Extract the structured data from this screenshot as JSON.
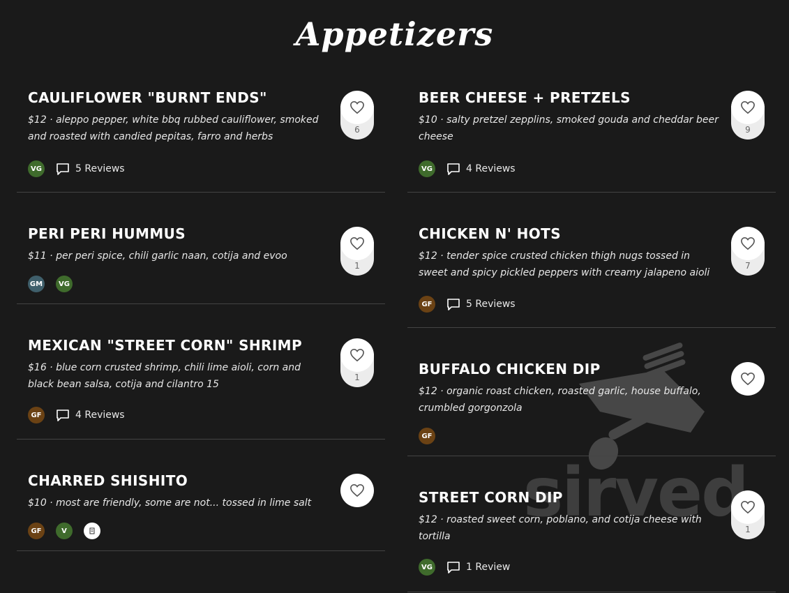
{
  "page": {
    "title": "Appetizers"
  },
  "colors": {
    "background": "#1a1a1a",
    "tag_VG": "#3f6b2c",
    "tag_GF": "#6b4214",
    "tag_GM": "#3f5f6b",
    "tag_V": "#3f6b2c"
  },
  "left_items": [
    {
      "name": "CAULIFLOWER \"BURNT ENDS\"",
      "description": "$12 · aleppo pepper, white bbq rubbed cauliflower, smoked and roasted with candied pepitas, farro and herbs",
      "tags": [
        "VG"
      ],
      "reviews": "5 Reviews",
      "likes": "6"
    },
    {
      "name": "PERI PERI HUMMUS",
      "description": "$11 · per peri spice, chili garlic naan, cotija and evoo",
      "tags": [
        "GM",
        "VG"
      ],
      "reviews": "",
      "likes": "1"
    },
    {
      "name": "MEXICAN \"STREET CORN\" SHRIMP",
      "description": "$16 · blue corn crusted shrimp, chili lime aioli, corn and black bean salsa, cotija and cilantro 15",
      "tags": [
        "GF"
      ],
      "reviews": "4 Reviews",
      "likes": "1"
    },
    {
      "name": "CHARRED SHISHITO",
      "description": "$10 · most are friendly, some are not... tossed in lime salt",
      "tags": [
        "GF",
        "V",
        "menu-icon"
      ],
      "reviews": "",
      "likes": ""
    }
  ],
  "right_items": [
    {
      "name": "BEER CHEESE + PRETZELS",
      "description": "$10 · salty pretzel zepplins, smoked gouda and cheddar beer cheese",
      "tags": [
        "VG"
      ],
      "reviews": "4 Reviews",
      "likes": "9"
    },
    {
      "name": "CHICKEN N' HOTS",
      "description": "$12 · tender spice crusted chicken thigh nugs tossed in sweet and spicy pickled peppers with creamy jalapeno aioli",
      "tags": [
        "GF"
      ],
      "reviews": "5 Reviews",
      "likes": "7"
    },
    {
      "name": "BUFFALO CHICKEN DIP",
      "description": "$12 · organic roast chicken, roasted garlic, house buffalo, crumbled gorgonzola",
      "tags": [
        "GF"
      ],
      "reviews": "",
      "likes": ""
    },
    {
      "name": "STREET CORN DIP",
      "description": "$12 · roasted sweet corn, poblano, and cotija cheese with tortilla",
      "tags": [
        "VG"
      ],
      "reviews": "1 Review",
      "likes": "1"
    }
  ],
  "watermark": {
    "text": "sirved",
    "icon": "fork-spoon-knife-icon"
  }
}
